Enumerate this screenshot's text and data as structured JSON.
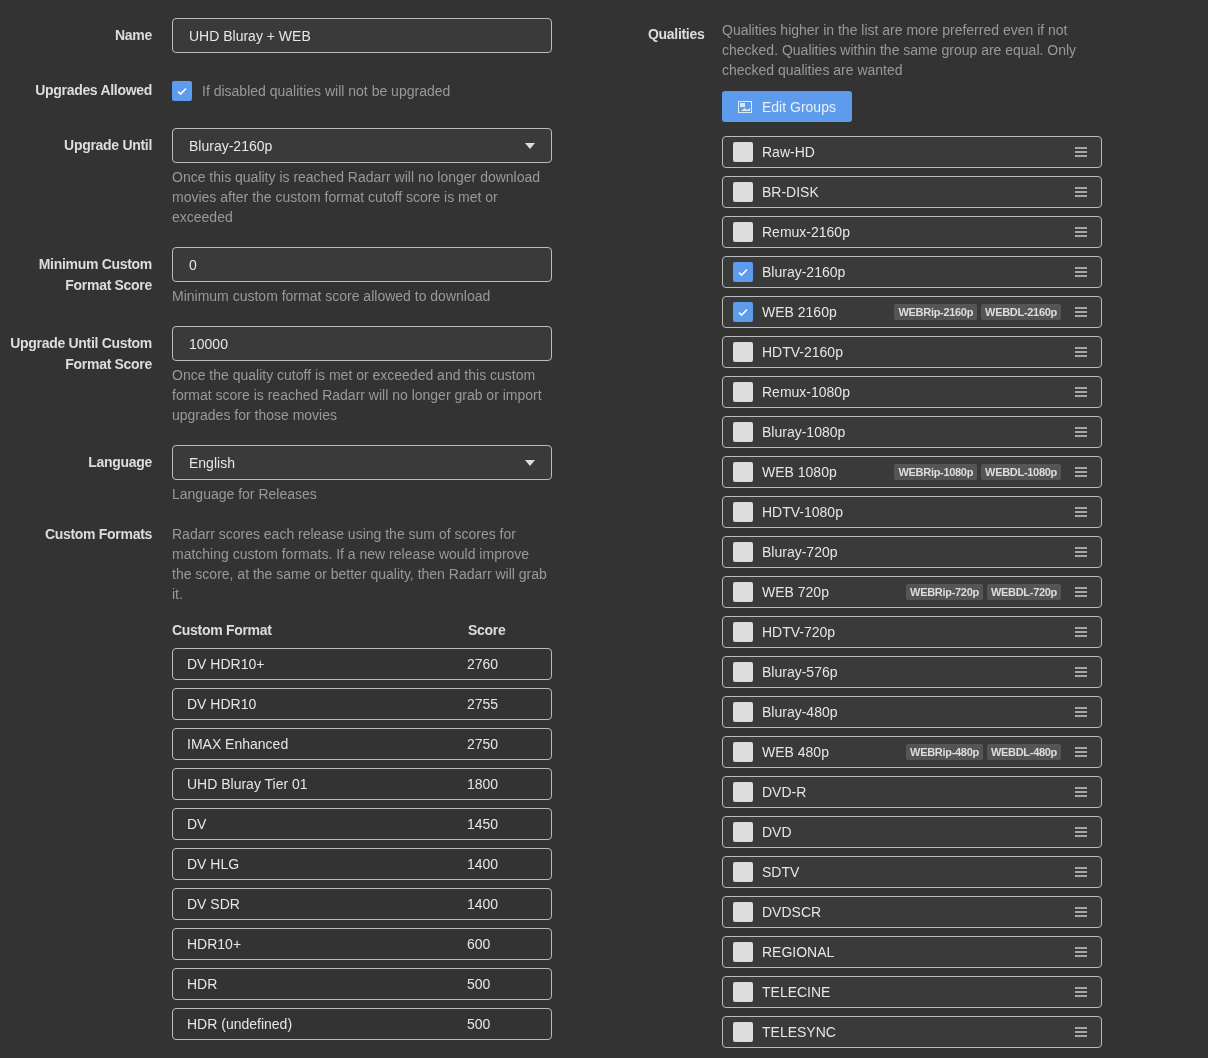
{
  "form": {
    "name": {
      "label": "Name",
      "value": "UHD Bluray + WEB"
    },
    "upgrades_allowed": {
      "label": "Upgrades Allowed",
      "checked": true,
      "help": "If disabled qualities will not be upgraded"
    },
    "upgrade_until": {
      "label": "Upgrade Until",
      "value": "Bluray-2160p",
      "help": "Once this quality is reached Radarr will no longer download movies after the custom format cutoff score is met or exceeded"
    },
    "min_custom_format_score": {
      "label": "Minimum Custom Format Score",
      "value": "0",
      "help": "Minimum custom format score allowed to download"
    },
    "upgrade_until_custom_format_score": {
      "label": "Upgrade Until Custom Format Score",
      "value": "10000",
      "help": "Once the quality cutoff is met or exceeded and this custom format score is reached Radarr will no longer grab or import upgrades for those movies"
    },
    "language": {
      "label": "Language",
      "value": "English",
      "help": "Language for Releases"
    },
    "custom_formats": {
      "label": "Custom Formats",
      "help": "Radarr scores each release using the sum of scores for matching custom formats. If a new release would improve the score, at the same or better quality, then Radarr will grab it.",
      "columns": [
        "Custom Format",
        "Score"
      ],
      "rows": [
        {
          "name": "DV HDR10+",
          "score": "2760"
        },
        {
          "name": "DV HDR10",
          "score": "2755"
        },
        {
          "name": "IMAX Enhanced",
          "score": "2750"
        },
        {
          "name": "UHD Bluray Tier 01",
          "score": "1800"
        },
        {
          "name": "DV",
          "score": "1450"
        },
        {
          "name": "DV HLG",
          "score": "1400"
        },
        {
          "name": "DV SDR",
          "score": "1400"
        },
        {
          "name": "HDR10+",
          "score": "600"
        },
        {
          "name": "HDR",
          "score": "500"
        },
        {
          "name": "HDR (undefined)",
          "score": "500"
        }
      ]
    }
  },
  "qualities": {
    "label": "Qualities",
    "help": "Qualities higher in the list are more preferred even if not checked. Qualities within the same group are equal. Only checked qualities are wanted",
    "edit_button": "Edit Groups",
    "items": [
      {
        "name": "Raw-HD",
        "checked": false
      },
      {
        "name": "BR-DISK",
        "checked": false
      },
      {
        "name": "Remux-2160p",
        "checked": false
      },
      {
        "name": "Bluray-2160p",
        "checked": true
      },
      {
        "name": "WEB 2160p",
        "checked": true,
        "tags": [
          "WEBRip-2160p",
          "WEBDL-2160p"
        ]
      },
      {
        "name": "HDTV-2160p",
        "checked": false
      },
      {
        "name": "Remux-1080p",
        "checked": false
      },
      {
        "name": "Bluray-1080p",
        "checked": false
      },
      {
        "name": "WEB 1080p",
        "checked": false,
        "tags": [
          "WEBRip-1080p",
          "WEBDL-1080p"
        ]
      },
      {
        "name": "HDTV-1080p",
        "checked": false
      },
      {
        "name": "Bluray-720p",
        "checked": false
      },
      {
        "name": "WEB 720p",
        "checked": false,
        "tags": [
          "WEBRip-720p",
          "WEBDL-720p"
        ]
      },
      {
        "name": "HDTV-720p",
        "checked": false
      },
      {
        "name": "Bluray-576p",
        "checked": false
      },
      {
        "name": "Bluray-480p",
        "checked": false
      },
      {
        "name": "WEB 480p",
        "checked": false,
        "tags": [
          "WEBRip-480p",
          "WEBDL-480p"
        ]
      },
      {
        "name": "DVD-R",
        "checked": false
      },
      {
        "name": "DVD",
        "checked": false
      },
      {
        "name": "SDTV",
        "checked": false
      },
      {
        "name": "DVDSCR",
        "checked": false
      },
      {
        "name": "REGIONAL",
        "checked": false
      },
      {
        "name": "TELECINE",
        "checked": false
      },
      {
        "name": "TELESYNC",
        "checked": false
      }
    ]
  }
}
